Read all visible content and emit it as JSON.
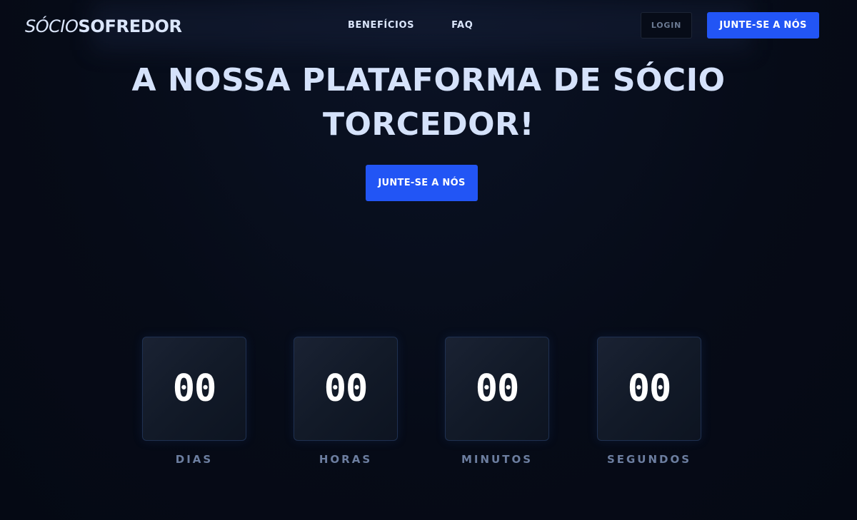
{
  "header": {
    "logo_light": "SÓCIO",
    "logo_bold": "SOFREDOR",
    "nav": [
      "BENEFÍCIOS",
      "FAQ"
    ],
    "login_label": "LOGIN",
    "join_label": "JUNTE-SE A NÓS"
  },
  "hero": {
    "title": "A NOSSA PLATAFORMA DE SÓCIO TORCEDOR!",
    "cta_label": "JUNTE-SE A NÓS"
  },
  "countdown": [
    {
      "value": "00",
      "label": "DIAS"
    },
    {
      "value": "00",
      "label": "HORAS"
    },
    {
      "value": "00",
      "label": "MINUTOS"
    },
    {
      "value": "00",
      "label": "SEGUNDOS"
    }
  ],
  "colors": {
    "background": "#060b17",
    "accent": "#2255f5",
    "title_text": "#d5e2fb",
    "label_text": "#6c7ea0"
  }
}
